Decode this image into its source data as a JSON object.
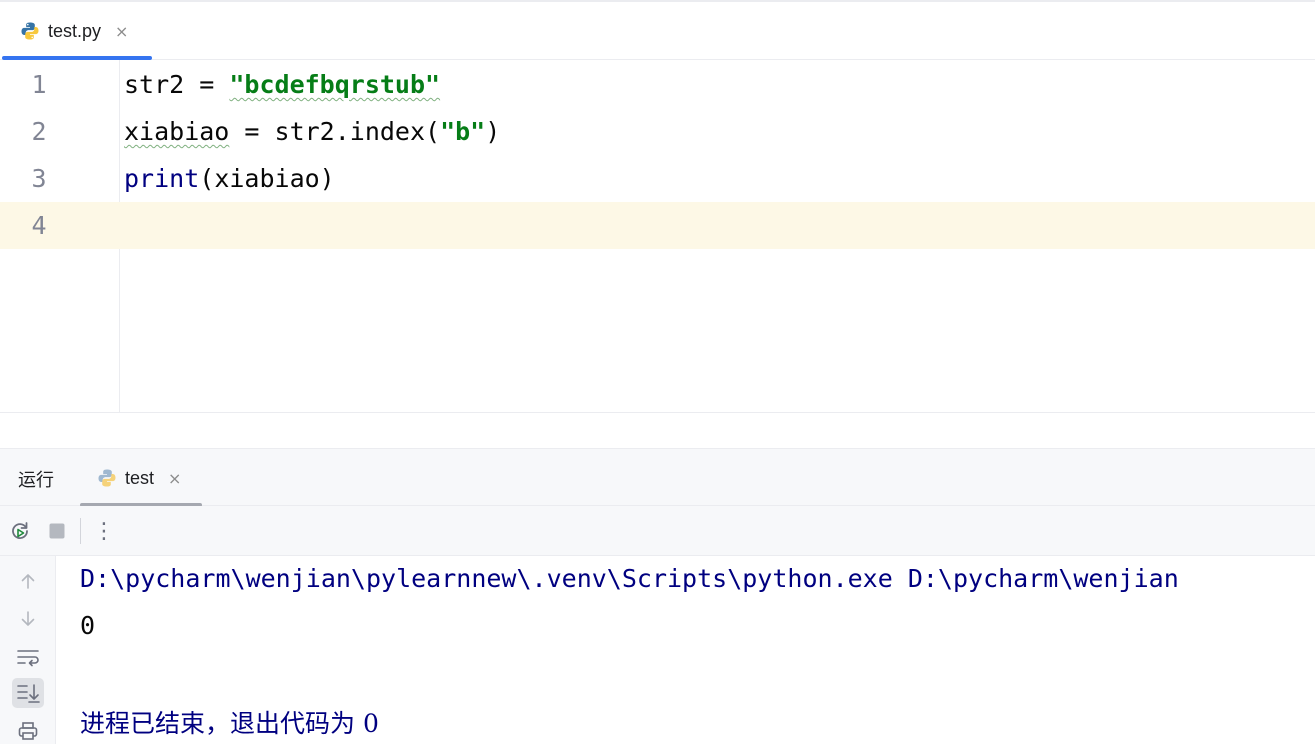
{
  "editor": {
    "tab": {
      "label": "test.py",
      "icon": "python-file-icon",
      "close": "×"
    },
    "lines": [
      {
        "number": "1",
        "tokens": [
          {
            "text": "str2 = ",
            "kind": "plain"
          },
          {
            "text": "\"bcdefbqrstub\"",
            "kind": "string",
            "squiggle": true
          }
        ]
      },
      {
        "number": "2",
        "tokens": [
          {
            "text": "xiabiao",
            "kind": "plain",
            "squiggle": true
          },
          {
            "text": " = str2.index(",
            "kind": "plain"
          },
          {
            "text": "\"b\"",
            "kind": "string"
          },
          {
            "text": ")",
            "kind": "plain"
          }
        ]
      },
      {
        "number": "3",
        "tokens": [
          {
            "text": "print",
            "kind": "keyword"
          },
          {
            "text": "(xiabiao)",
            "kind": "plain"
          }
        ]
      },
      {
        "number": "4",
        "tokens": [],
        "current": true
      }
    ]
  },
  "run": {
    "title": "运行",
    "tab": {
      "label": "test",
      "icon": "python-icon",
      "close": "×"
    },
    "toolbar": {
      "rerun_icon": "rerun-icon",
      "stop_icon": "stop-icon",
      "more_icon": "more-vertical-icon",
      "more_glyph": "⋮"
    },
    "side_actions": [
      "up-arrow-icon",
      "down-arrow-icon",
      "soft-wrap-icon",
      "scroll-to-end-icon",
      "print-icon"
    ],
    "console": {
      "command": "D:\\pycharm\\wenjian\\pylearnnew\\.venv\\Scripts\\python.exe D:\\pycharm\\wenjian",
      "output": "0",
      "exit_message": "进程已结束，退出代码为 0"
    }
  },
  "colors": {
    "accent": "#3574f0",
    "string": "#067d17",
    "keyword": "#000080",
    "current_line": "#fdf8e6"
  }
}
